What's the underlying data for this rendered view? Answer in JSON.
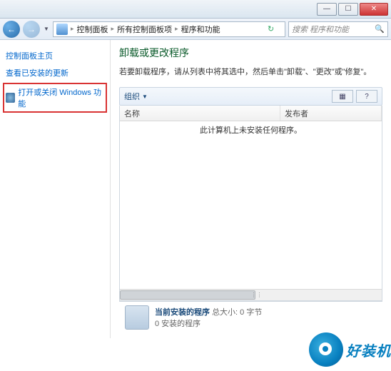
{
  "window": {
    "min": "—",
    "max": "☐",
    "close": "✕"
  },
  "nav": {
    "back": "←",
    "forward": "→",
    "dropdown": "▼",
    "breadcrumb": {
      "sep1": "▸",
      "item1": "控制面板",
      "sep2": "▸",
      "item2": "所有控制面板项",
      "sep3": "▸",
      "item3": "程序和功能"
    },
    "refresh": "↻",
    "search_placeholder": "搜索 程序和功能",
    "search_icon": "🔍"
  },
  "sidebar": {
    "items": [
      {
        "label": "控制面板主页"
      },
      {
        "label": "查看已安装的更新"
      },
      {
        "label": "打开或关闭 Windows 功能"
      }
    ]
  },
  "main": {
    "title": "卸载或更改程序",
    "desc": "若要卸载程序，请从列表中将其选中，然后单击\"卸载\"、\"更改\"或\"修复\"。",
    "toolbar": {
      "organize": "组织",
      "org_arrow": "▼",
      "view1": "▦",
      "view2": "?"
    },
    "columns": {
      "name": "名称",
      "publisher": "发布者"
    },
    "empty": "此计算机上未安装任何程序。"
  },
  "status": {
    "line1_a": "当前安装的程序",
    "line1_b": "总大小: 0 字节",
    "line2": "0 安装的程序"
  },
  "watermark": {
    "text": "好装机"
  }
}
